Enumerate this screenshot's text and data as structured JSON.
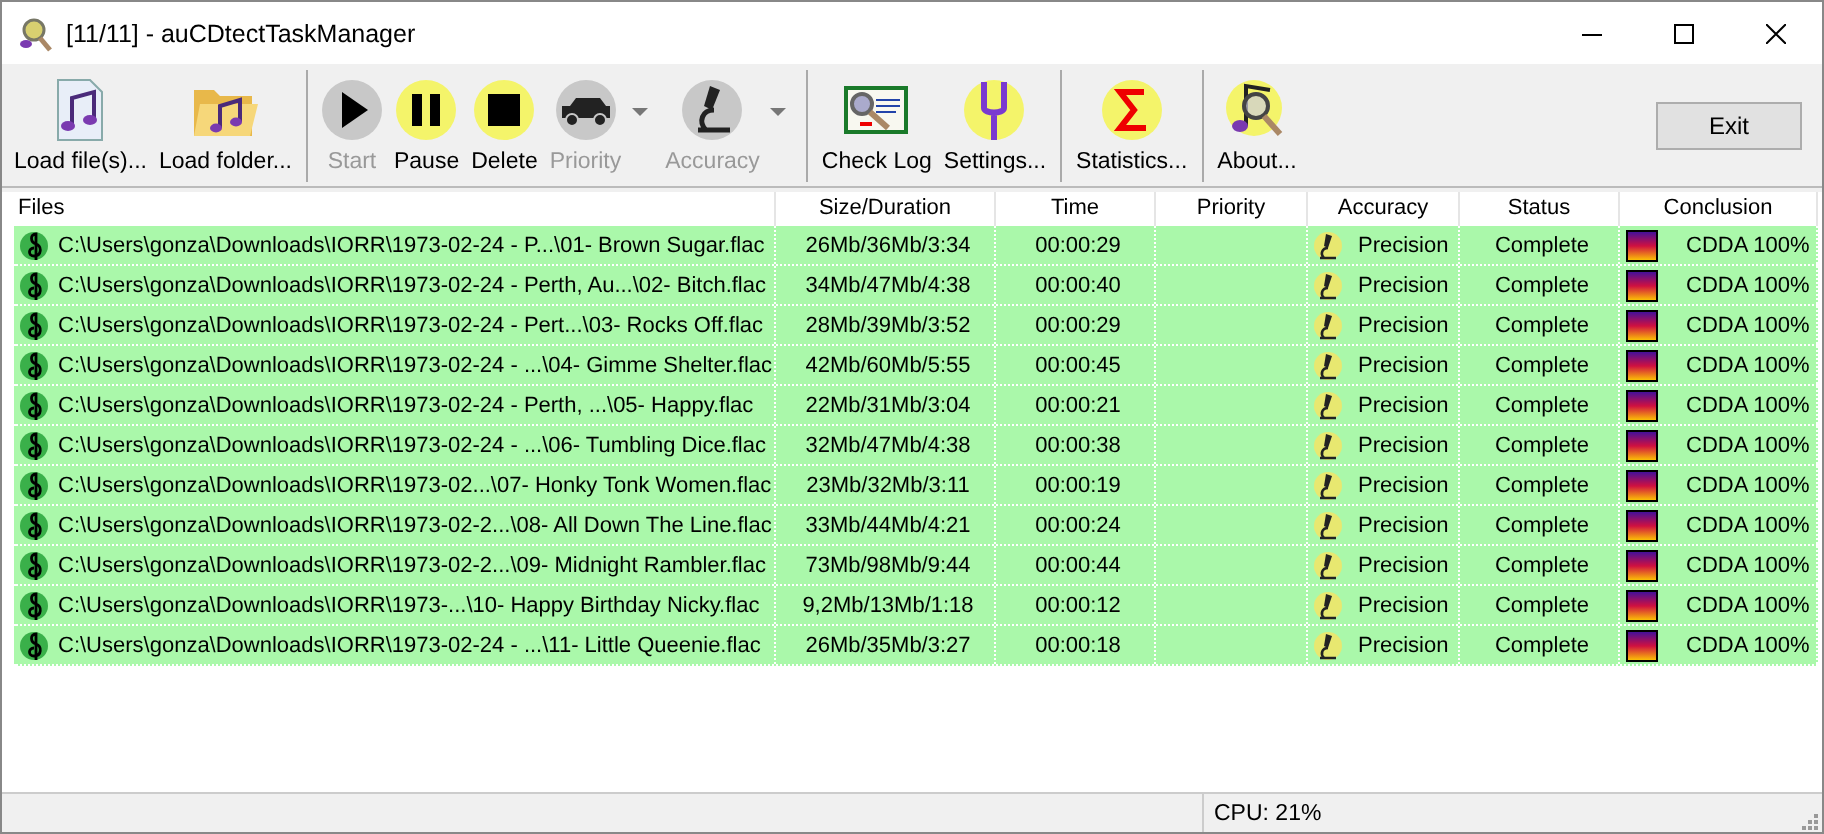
{
  "window": {
    "title": "[11/11] - auCDtectTaskManager"
  },
  "toolbar": {
    "groups": [
      [
        {
          "label": "Load file(s)...",
          "enabled": true,
          "dropdown": false
        },
        {
          "label": "Load folder...",
          "enabled": true,
          "dropdown": false
        }
      ],
      [
        {
          "label": "Start",
          "enabled": false,
          "dropdown": false
        },
        {
          "label": "Pause",
          "enabled": true,
          "dropdown": false
        },
        {
          "label": "Delete",
          "enabled": true,
          "dropdown": false
        },
        {
          "label": "Priority",
          "enabled": false,
          "dropdown": true
        },
        {
          "label": "Accuracy",
          "enabled": false,
          "dropdown": true
        }
      ],
      [
        {
          "label": "Check Log",
          "enabled": true,
          "dropdown": false
        },
        {
          "label": "Settings...",
          "enabled": true,
          "dropdown": false
        }
      ],
      [
        {
          "label": "Statistics...",
          "enabled": true,
          "dropdown": false
        }
      ],
      [
        {
          "label": "About...",
          "enabled": true,
          "dropdown": false
        }
      ]
    ],
    "exit_button": "Exit"
  },
  "table": {
    "columns": [
      "Files",
      "Size/Duration",
      "Time",
      "Priority",
      "Accuracy",
      "Status",
      "Conclusion"
    ],
    "rows": [
      {
        "file": "C:\\Users\\gonza\\Downloads\\IORR\\1973-02-24 - P...\\01- Brown Sugar.flac",
        "size_duration": "26Mb/36Mb/3:34",
        "time": "00:00:29",
        "accuracy": "Precision",
        "status": "Complete",
        "conclusion": "CDDA 100%"
      },
      {
        "file": "C:\\Users\\gonza\\Downloads\\IORR\\1973-02-24 - Perth, Au...\\02- Bitch.flac",
        "size_duration": "34Mb/47Mb/4:38",
        "time": "00:00:40",
        "accuracy": "Precision",
        "status": "Complete",
        "conclusion": "CDDA 100%"
      },
      {
        "file": "C:\\Users\\gonza\\Downloads\\IORR\\1973-02-24 - Pert...\\03- Rocks Off.flac",
        "size_duration": "28Mb/39Mb/3:52",
        "time": "00:00:29",
        "accuracy": "Precision",
        "status": "Complete",
        "conclusion": "CDDA 100%"
      },
      {
        "file": "C:\\Users\\gonza\\Downloads\\IORR\\1973-02-24 - ...\\04- Gimme Shelter.flac",
        "size_duration": "42Mb/60Mb/5:55",
        "time": "00:00:45",
        "accuracy": "Precision",
        "status": "Complete",
        "conclusion": "CDDA 100%"
      },
      {
        "file": "C:\\Users\\gonza\\Downloads\\IORR\\1973-02-24 - Perth, ...\\05- Happy.flac",
        "size_duration": "22Mb/31Mb/3:04",
        "time": "00:00:21",
        "accuracy": "Precision",
        "status": "Complete",
        "conclusion": "CDDA 100%"
      },
      {
        "file": "C:\\Users\\gonza\\Downloads\\IORR\\1973-02-24 - ...\\06- Tumbling Dice.flac",
        "size_duration": "32Mb/47Mb/4:38",
        "time": "00:00:38",
        "accuracy": "Precision",
        "status": "Complete",
        "conclusion": "CDDA 100%"
      },
      {
        "file": "C:\\Users\\gonza\\Downloads\\IORR\\1973-02...\\07- Honky Tonk Women.flac",
        "size_duration": "23Mb/32Mb/3:11",
        "time": "00:00:19",
        "accuracy": "Precision",
        "status": "Complete",
        "conclusion": "CDDA 100%"
      },
      {
        "file": "C:\\Users\\gonza\\Downloads\\IORR\\1973-02-2...\\08- All Down The Line.flac",
        "size_duration": "33Mb/44Mb/4:21",
        "time": "00:00:24",
        "accuracy": "Precision",
        "status": "Complete",
        "conclusion": "CDDA 100%"
      },
      {
        "file": "C:\\Users\\gonza\\Downloads\\IORR\\1973-02-2...\\09- Midnight Rambler.flac",
        "size_duration": "73Mb/98Mb/9:44",
        "time": "00:00:44",
        "accuracy": "Precision",
        "status": "Complete",
        "conclusion": "CDDA 100%"
      },
      {
        "file": "C:\\Users\\gonza\\Downloads\\IORR\\1973-...\\10- Happy Birthday Nicky.flac",
        "size_duration": "9,2Mb/13Mb/1:18",
        "time": "00:00:12",
        "accuracy": "Precision",
        "status": "Complete",
        "conclusion": "CDDA 100%"
      },
      {
        "file": "C:\\Users\\gonza\\Downloads\\IORR\\1973-02-24 - ...\\11- Little Queenie.flac",
        "size_duration": "26Mb/35Mb/3:27",
        "time": "00:00:18",
        "accuracy": "Precision",
        "status": "Complete",
        "conclusion": "CDDA 100%"
      }
    ]
  },
  "status_bar": {
    "cpu": "CPU: 21%"
  }
}
